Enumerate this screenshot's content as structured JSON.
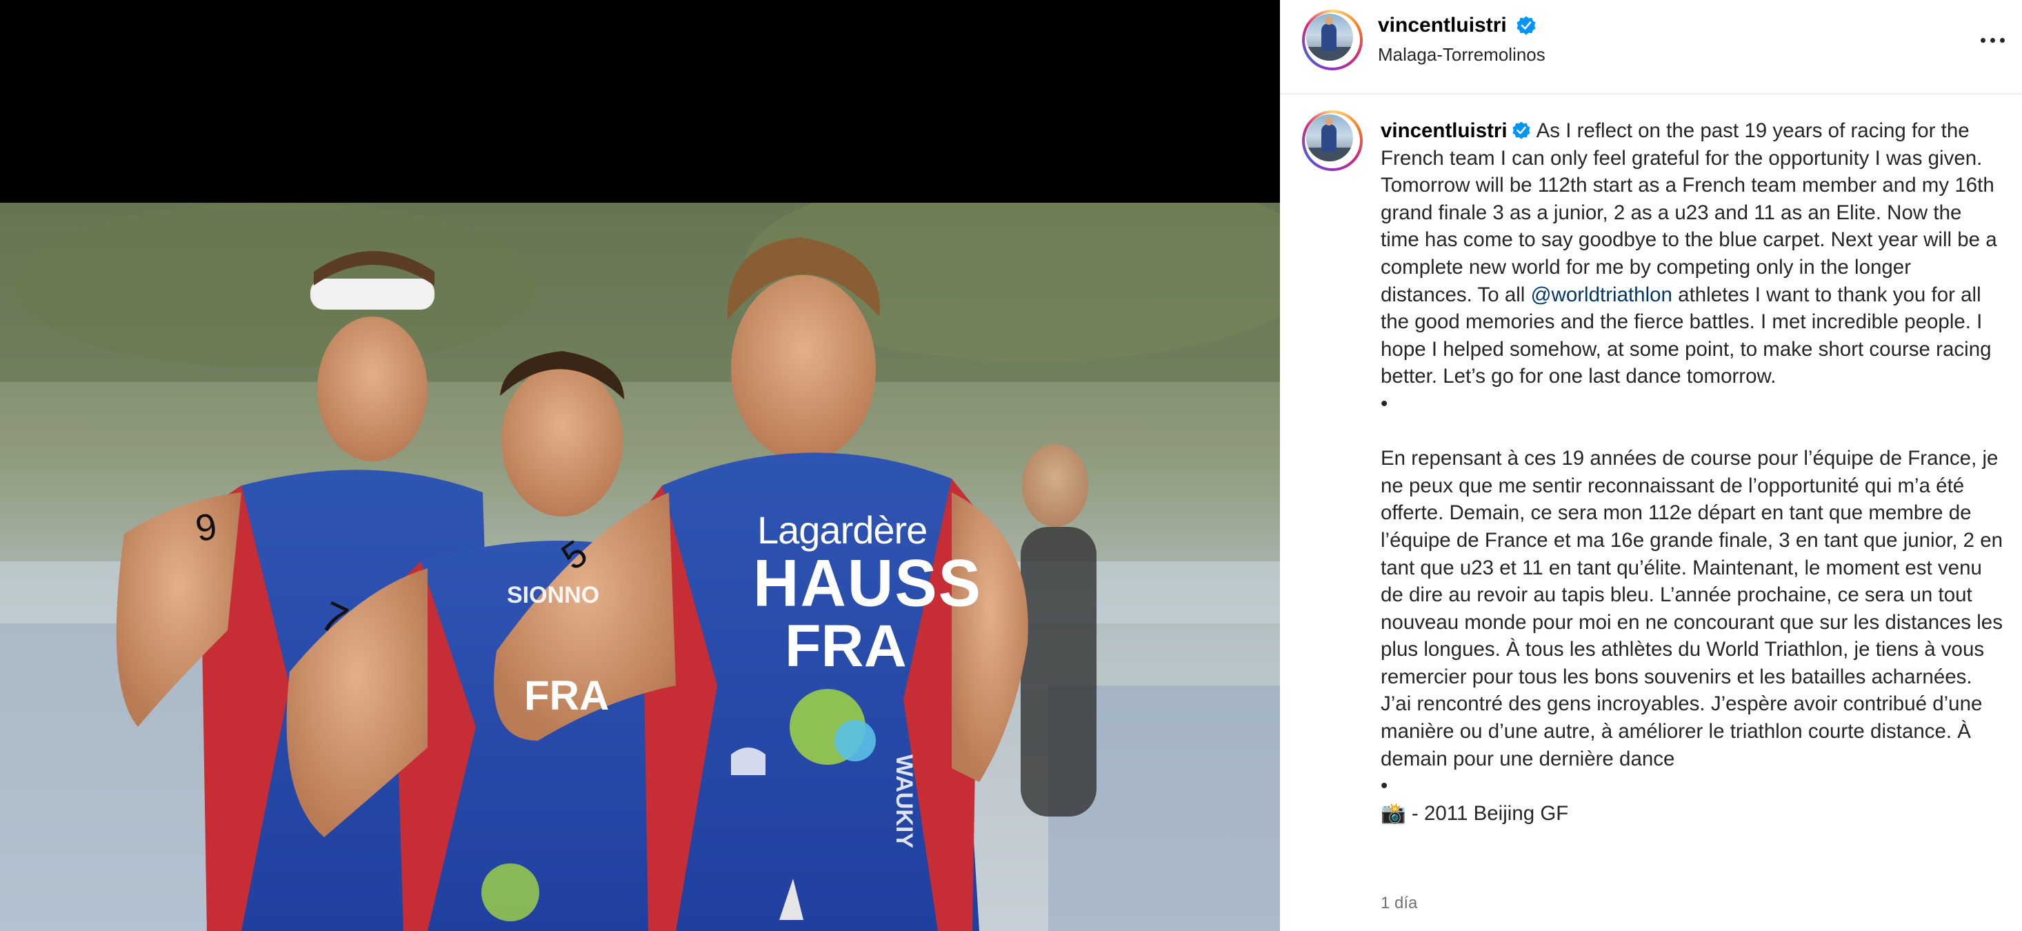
{
  "post": {
    "username": "vincentluistri",
    "location": "Malaga-Torremolinos",
    "verified_icon": "verified-badge-icon",
    "more_icon": "more-options-icon",
    "caption_en_before_mention": "As I reflect on the past 19 years of racing for the French team I can only feel grateful for the opportunity I was given. Tomorrow will be 112th start as a French team member and my 16th grand finale 3 as a junior, 2 as a u23 and 11 as an Elite. Now the time has come to say goodbye to the blue carpet. Next year will be a complete new world for me by competing only in the longer distances. To all",
    "mention": "@worldtriathlon",
    "caption_en_after_mention": "athletes I want to thank you for all the good memories and the fierce battles. I met incredible people. I hope I helped somehow, at some point, to make short course racing better. Let’s go for one last dance tomorrow.",
    "bullet1": "•",
    "caption_fr": "En repensant à ces 19 années de course pour l’équipe de France, je ne peux que me sentir reconnaissant de l’opportunité qui m’a été offerte. Demain, ce sera mon 112e départ en tant que membre de l’équipe de France et ma 16e grande finale, 3 en tant que junior, 2 en tant que u23 et 11 en tant qu’élite. Maintenant, le moment est venu de dire au revoir au tapis bleu. L’année prochaine, ce sera un tout nouveau monde pour moi en ne concourant que sur les distances les plus longues. À tous les athlètes du World Triathlon, je tiens à vous remercier pour tous les bons souvenirs et les batailles acharnées. J’ai rencontré des gens incroyables. J’espère avoir contribué d’une manière ou d’une autre, à améliorer le triathlon courte distance. À demain pour une dernière dance",
    "bullet2": "•",
    "photo_credit": "📸 - 2011 Beijing GF",
    "timestamp": "1 día"
  },
  "photo": {
    "jersey_sponsor": "Lagardère",
    "jersey_name": "HAUSS",
    "jersey_country": "FRA",
    "left_country": "FRA",
    "race_numbers": [
      "9",
      "5",
      "7"
    ],
    "partial_texts": [
      "SIONNO",
      "WAUKIY"
    ]
  }
}
